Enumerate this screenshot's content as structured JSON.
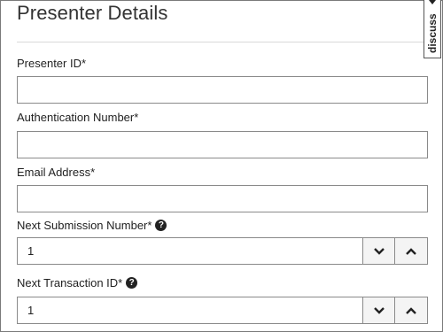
{
  "header": {
    "title": "Presenter Details"
  },
  "fields": {
    "presenter_id": {
      "label": "Presenter ID*",
      "value": ""
    },
    "auth_number": {
      "label": "Authentication Number*",
      "value": ""
    },
    "email": {
      "label": "Email Address*",
      "value": ""
    },
    "next_submission": {
      "label": "Next Submission Number*",
      "value": "1",
      "help_icon": "question-circle-icon"
    },
    "next_transaction": {
      "label": "Next Transaction ID*",
      "value": "1",
      "help_icon": "question-circle-icon"
    }
  },
  "help_glyph": "?",
  "discuss_tab": {
    "label": "discuss"
  }
}
